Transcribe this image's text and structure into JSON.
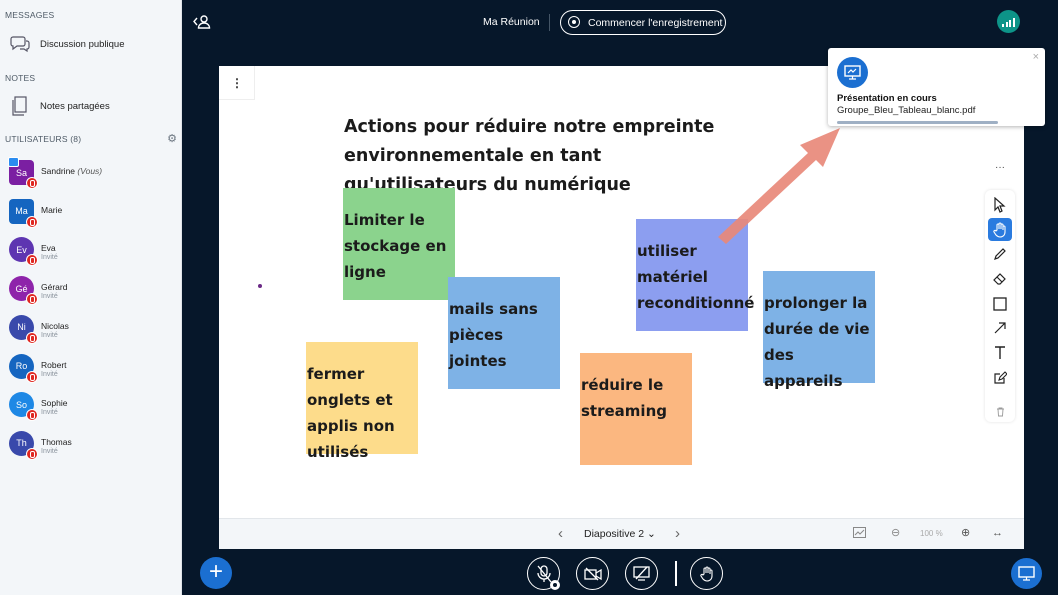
{
  "sidebar": {
    "messages_title": "MESSAGES",
    "public_chat": "Discussion publique",
    "notes_title": "NOTES",
    "shared_notes": "Notes partagées",
    "users_title": "UTILISATEURS (8)",
    "users": [
      {
        "initials": "Sa",
        "name": "Sandrine",
        "suffix": "(Vous)",
        "role": "",
        "color": "#7B1FA2",
        "shape": "square",
        "presenter": true
      },
      {
        "initials": "Ma",
        "name": "Marie",
        "suffix": "",
        "role": "",
        "color": "#1565C0",
        "shape": "square",
        "presenter": false
      },
      {
        "initials": "Ev",
        "name": "Eva",
        "suffix": "",
        "role": "Invité",
        "color": "#5E35B1",
        "shape": "round",
        "presenter": false
      },
      {
        "initials": "Gé",
        "name": "Gérard",
        "suffix": "",
        "role": "Invité",
        "color": "#8E24AA",
        "shape": "round",
        "presenter": false
      },
      {
        "initials": "Ni",
        "name": "Nicolas",
        "suffix": "",
        "role": "Invité",
        "color": "#3949AB",
        "shape": "round",
        "presenter": false
      },
      {
        "initials": "Ro",
        "name": "Robert",
        "suffix": "",
        "role": "Invité",
        "color": "#1565C0",
        "shape": "round",
        "presenter": false
      },
      {
        "initials": "So",
        "name": "Sophie",
        "suffix": "",
        "role": "Invité",
        "color": "#1E88E5",
        "shape": "round",
        "presenter": false
      },
      {
        "initials": "Th",
        "name": "Thomas",
        "suffix": "",
        "role": "Invité",
        "color": "#3949AB",
        "shape": "round",
        "presenter": false
      }
    ]
  },
  "topbar": {
    "meeting_title": "Ma Réunion",
    "record_label": "Commencer l'enregistrement"
  },
  "slide": {
    "title_line1": "Actions pour réduire notre empreinte environnementale en tant",
    "title_line2": "qu'utilisateurs du numérique",
    "notes": [
      {
        "text": "Limiter le stockage en ligne",
        "color": "#8BD38D"
      },
      {
        "text": "mails sans pièces jointes",
        "color": "#7EB2E6"
      },
      {
        "text": "fermer onglets et applis non utilisés",
        "color": "#FDDC8B"
      },
      {
        "text": "réduire le streaming",
        "color": "#FBB780"
      },
      {
        "text": "utiliser matériel reconditionné",
        "color": "#8C9EF0"
      },
      {
        "text": "prolonger la durée de vie des appareils",
        "color": "#7EB2E6"
      }
    ]
  },
  "board_footer": {
    "slide_label": "Diapositive 2",
    "zoom_label": "100 %"
  },
  "notification": {
    "title": "Présentation en cours",
    "file": "Groupe_Bleu_Tableau_blanc.pdf"
  },
  "colors": {
    "accent": "#1B6FD1",
    "background": "#06172A",
    "arrow": "#E8897A"
  }
}
